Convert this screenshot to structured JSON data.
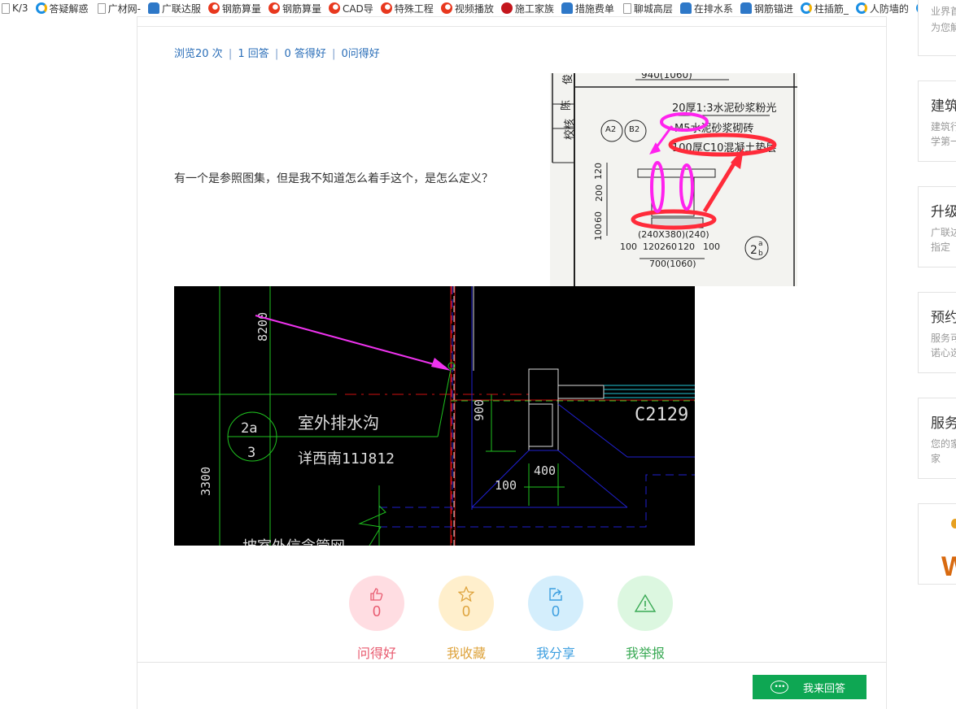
{
  "bookmarks": [
    {
      "icon": "page-icon",
      "label": "K/3"
    },
    {
      "icon": "ie-icon",
      "label": "答疑解惑"
    },
    {
      "icon": "page-icon",
      "label": "广材网-"
    },
    {
      "icon": "user-icon",
      "label": "广联达服"
    },
    {
      "icon": "swirl-icon",
      "label": "钢筋算量"
    },
    {
      "icon": "swirl-icon",
      "label": "钢筋算量"
    },
    {
      "icon": "swirl-icon",
      "label": "CAD导"
    },
    {
      "icon": "swirl-icon",
      "label": "特殊工程"
    },
    {
      "icon": "swirl-icon",
      "label": "视频播放"
    },
    {
      "icon": "shi-icon",
      "label": "施工家族"
    },
    {
      "icon": "user-icon",
      "label": "措施费单"
    },
    {
      "icon": "page-icon",
      "label": "聊城高层"
    },
    {
      "icon": "user-icon",
      "label": "在排水系"
    },
    {
      "icon": "user-icon",
      "label": "钢筋锚进"
    },
    {
      "icon": "ie-icon",
      "label": "柱插筋_"
    },
    {
      "icon": "ie-icon",
      "label": "人防墙的"
    },
    {
      "icon": "ie-icon",
      "label": ""
    }
  ],
  "stats": {
    "views": "浏览20 次",
    "answers": "1 回答",
    "good_answers": "0 答得好",
    "good_questions": "0问得好",
    "separator": "|"
  },
  "question": {
    "text": "有一个是参照图集，但是我不知道怎么着手这个，是怎么定义？"
  },
  "image1": {
    "labels": {
      "top_dim": "940(1060)",
      "line1": "20厚1:3水泥砂浆粉光",
      "line2": "M5水泥砂浆砌砖",
      "line3": "100厚C10混凝土垫层",
      "a2": "A2",
      "b2": "B2",
      "dims_left": [
        "120",
        "200",
        "200",
        "60",
        "100"
      ],
      "dim_mid": "(240X380)(240)",
      "dim_row": [
        "100",
        "120",
        "260",
        "120",
        "100"
      ],
      "dim_total": "700(1060)",
      "detail_top": "2",
      "detail_a": "a",
      "detail_b": "b",
      "titleblock": [
        "校核",
        "陈",
        "俊"
      ]
    }
  },
  "image2": {
    "labels": {
      "dim_8200": "8200",
      "dim_3300": "3300",
      "detail_top": "2a",
      "detail_bottom": "3",
      "note1": "室外排水沟",
      "note2": "详西南11J812",
      "dim_900": "900",
      "dim_400": "400",
      "dim_100": "100",
      "window": "C2129",
      "bottom_text": "坡室外信念管网"
    }
  },
  "actions": [
    {
      "name": "like",
      "icon": "thumbs-up-icon",
      "count": "0",
      "label": "问得好",
      "color": "#e8596e",
      "bg": "#ffdde2"
    },
    {
      "name": "favorite",
      "icon": "star-icon",
      "count": "0",
      "label": "我收藏",
      "color": "#dea33c",
      "bg": "#ffefcc"
    },
    {
      "name": "share",
      "icon": "share-icon",
      "count": "0",
      "label": "我分享",
      "color": "#3d9fe0",
      "bg": "#d4eefc"
    },
    {
      "name": "report",
      "icon": "warning-icon",
      "count": "",
      "label": "我举报",
      "color": "#3aaa55",
      "bg": "#dcf7e0"
    }
  ],
  "answer_button": {
    "label": "我来回答",
    "icon": "chat-bubble-icon"
  },
  "sidebar": [
    {
      "title": "",
      "desc": [
        "业界首",
        "为您解"
      ]
    },
    {
      "title": "建筑",
      "desc": [
        "建筑行",
        "学第一"
      ]
    },
    {
      "title": "升级",
      "desc": [
        "广联达",
        "指定"
      ]
    },
    {
      "title": "预约",
      "desc": [
        "服务可",
        "诺心选"
      ]
    },
    {
      "title": "服务",
      "desc": [
        "您的家",
        "家"
      ]
    },
    {
      "title": "",
      "desc": []
    }
  ]
}
